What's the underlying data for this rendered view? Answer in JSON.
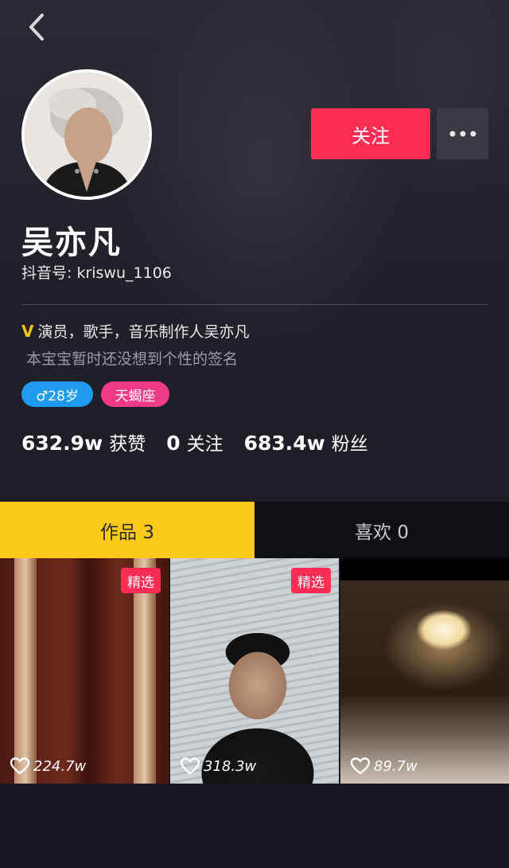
{
  "profile": {
    "name": "吴亦凡",
    "douyin_id": "抖音号: kriswu_1106",
    "verify_mark": "V",
    "verified_desc": "演员，歌手，音乐制作人吴亦凡",
    "signature": "本宝宝暂时还没想到个性的签名",
    "tags": {
      "gender_age": "♂28岁",
      "zodiac": "天蝎座"
    }
  },
  "actions": {
    "follow_label": "关注",
    "more_icon": "more-horizontal-icon",
    "back_icon": "chevron-left-icon"
  },
  "stats": {
    "likes_value": "632.9w",
    "likes_label": "获赞",
    "following_value": "0",
    "following_label": "关注",
    "followers_value": "683.4w",
    "followers_label": "粉丝"
  },
  "tabs": {
    "works": "作品 3",
    "likes": "喜欢 0"
  },
  "videos": [
    {
      "badge": "精选",
      "likes": "224.7w"
    },
    {
      "badge": "精选",
      "likes": "318.3w"
    },
    {
      "badge": "",
      "likes": "89.7w"
    }
  ],
  "colors": {
    "accent_red": "#fd2c55",
    "tab_active_yellow": "#fcc917",
    "verify_gold": "#f8c61a",
    "gender_tag_blue": "#1e9bf0",
    "zodiac_tag_pink": "#f03a8a"
  }
}
